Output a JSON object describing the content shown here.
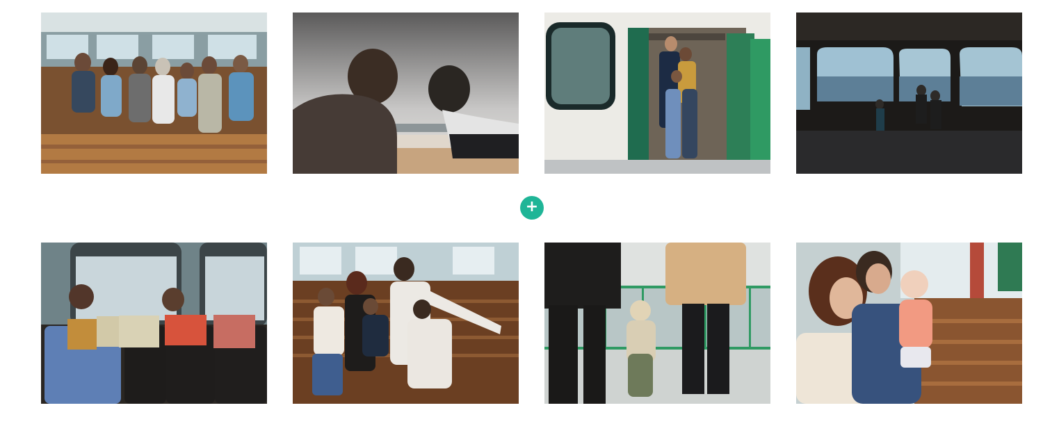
{
  "accent_color": "#1fb597",
  "gallery": {
    "photos": [
      {
        "subject": "family-on-ferry-bench"
      },
      {
        "subject": "mother-and-son-silhouette"
      },
      {
        "subject": "family-in-ferry-doorway"
      },
      {
        "subject": "kids-at-ferry-windows"
      },
      {
        "subject": "family-reading-books"
      },
      {
        "subject": "family-on-wooden-bench"
      },
      {
        "subject": "toddler-walking-with-parents"
      },
      {
        "subject": "couple-with-baby"
      }
    ]
  },
  "add_button": {
    "icon": "plus-icon",
    "glyph": "+"
  }
}
